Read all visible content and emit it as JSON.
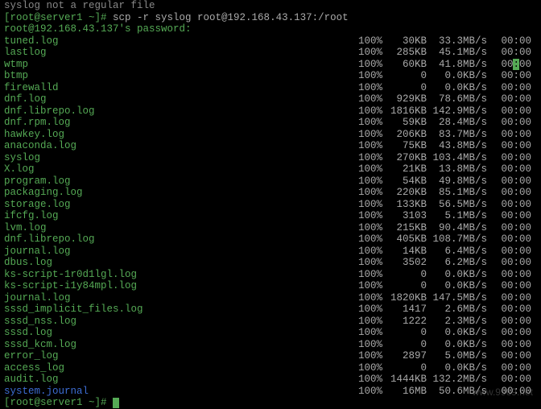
{
  "top_hint": "syslog  not a regular file",
  "prompt": {
    "label": "[root@server1 ~]# ",
    "command": "scp -r syslog root@192.168.43.137:/root"
  },
  "password_line": "root@192.168.43.137's password:",
  "rows": [
    {
      "name": "tuned.log",
      "dir": false,
      "pct": "100%",
      "size": "30KB",
      "speed": "33.3MB/s",
      "eta": "00:00"
    },
    {
      "name": "lastlog",
      "dir": false,
      "pct": "100%",
      "size": "285KB",
      "speed": "45.1MB/s",
      "eta": "00:00"
    },
    {
      "name": "wtmp",
      "dir": false,
      "pct": "100%",
      "size": "60KB",
      "speed": "41.8MB/s",
      "eta": "00:00",
      "hl": true
    },
    {
      "name": "btmp",
      "dir": false,
      "pct": "100%",
      "size": "0",
      "speed": "0.0KB/s",
      "eta": "00:00"
    },
    {
      "name": "firewalld",
      "dir": false,
      "pct": "100%",
      "size": "0",
      "speed": "0.0KB/s",
      "eta": "00:00"
    },
    {
      "name": "dnf.log",
      "dir": false,
      "pct": "100%",
      "size": "929KB",
      "speed": "78.6MB/s",
      "eta": "00:00"
    },
    {
      "name": "dnf.librepo.log",
      "dir": false,
      "pct": "100%",
      "size": "1816KB",
      "speed": "142.9MB/s",
      "eta": "00:00"
    },
    {
      "name": "dnf.rpm.log",
      "dir": false,
      "pct": "100%",
      "size": "59KB",
      "speed": "28.4MB/s",
      "eta": "00:00"
    },
    {
      "name": "hawkey.log",
      "dir": false,
      "pct": "100%",
      "size": "206KB",
      "speed": "83.7MB/s",
      "eta": "00:00"
    },
    {
      "name": "anaconda.log",
      "dir": false,
      "pct": "100%",
      "size": "75KB",
      "speed": "43.8MB/s",
      "eta": "00:00"
    },
    {
      "name": "syslog",
      "dir": false,
      "pct": "100%",
      "size": "270KB",
      "speed": "103.4MB/s",
      "eta": "00:00"
    },
    {
      "name": "X.log",
      "dir": false,
      "pct": "100%",
      "size": "21KB",
      "speed": "13.8MB/s",
      "eta": "00:00"
    },
    {
      "name": "program.log",
      "dir": false,
      "pct": "100%",
      "size": "54KB",
      "speed": "49.8MB/s",
      "eta": "00:00"
    },
    {
      "name": "packaging.log",
      "dir": false,
      "pct": "100%",
      "size": "220KB",
      "speed": "85.1MB/s",
      "eta": "00:00"
    },
    {
      "name": "storage.log",
      "dir": false,
      "pct": "100%",
      "size": "133KB",
      "speed": "56.5MB/s",
      "eta": "00:00"
    },
    {
      "name": "ifcfg.log",
      "dir": false,
      "pct": "100%",
      "size": "3103",
      "speed": "5.1MB/s",
      "eta": "00:00"
    },
    {
      "name": "lvm.log",
      "dir": false,
      "pct": "100%",
      "size": "215KB",
      "speed": "90.4MB/s",
      "eta": "00:00"
    },
    {
      "name": "dnf.librepo.log",
      "dir": false,
      "pct": "100%",
      "size": "405KB",
      "speed": "108.7MB/s",
      "eta": "00:00"
    },
    {
      "name": "journal.log",
      "dir": false,
      "pct": "100%",
      "size": "14KB",
      "speed": "6.4MB/s",
      "eta": "00:00"
    },
    {
      "name": "dbus.log",
      "dir": false,
      "pct": "100%",
      "size": "3502",
      "speed": "6.2MB/s",
      "eta": "00:00"
    },
    {
      "name": "ks-script-1r0d1lgl.log",
      "dir": false,
      "pct": "100%",
      "size": "0",
      "speed": "0.0KB/s",
      "eta": "00:00"
    },
    {
      "name": "ks-script-i1y84mpl.log",
      "dir": false,
      "pct": "100%",
      "size": "0",
      "speed": "0.0KB/s",
      "eta": "00:00"
    },
    {
      "name": "journal.log",
      "dir": false,
      "pct": "100%",
      "size": "1820KB",
      "speed": "147.5MB/s",
      "eta": "00:00"
    },
    {
      "name": "sssd_implicit_files.log",
      "dir": false,
      "pct": "100%",
      "size": "1417",
      "speed": "2.6MB/s",
      "eta": "00:00"
    },
    {
      "name": "sssd_nss.log",
      "dir": false,
      "pct": "100%",
      "size": "1222",
      "speed": "2.3MB/s",
      "eta": "00:00"
    },
    {
      "name": "sssd.log",
      "dir": false,
      "pct": "100%",
      "size": "0",
      "speed": "0.0KB/s",
      "eta": "00:00"
    },
    {
      "name": "sssd_kcm.log",
      "dir": false,
      "pct": "100%",
      "size": "0",
      "speed": "0.0KB/s",
      "eta": "00:00"
    },
    {
      "name": "error_log",
      "dir": false,
      "pct": "100%",
      "size": "2897",
      "speed": "5.0MB/s",
      "eta": "00:00"
    },
    {
      "name": "access_log",
      "dir": false,
      "pct": "100%",
      "size": "0",
      "speed": "0.0KB/s",
      "eta": "00:00"
    },
    {
      "name": "audit.log",
      "dir": false,
      "pct": "100%",
      "size": "1444KB",
      "speed": "132.2MB/s",
      "eta": "00:00"
    },
    {
      "name": "system.journal",
      "dir": true,
      "pct": "100%",
      "size": "16MB",
      "speed": "50.6MB/s",
      "eta": "00:00"
    }
  ],
  "final_prompt": "[root@server1 ~]# ",
  "watermark": "www.9969.net"
}
